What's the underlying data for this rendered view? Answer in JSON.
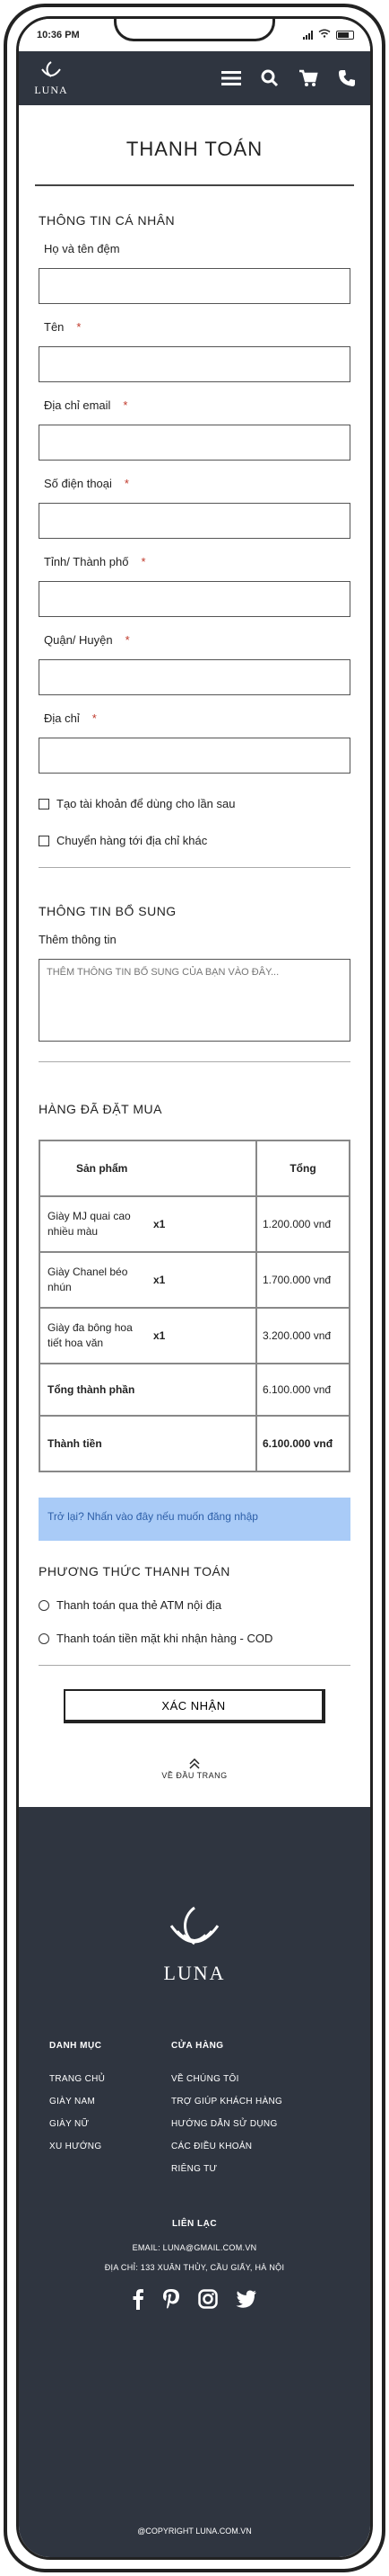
{
  "status_bar": {
    "time": "10:36 PM"
  },
  "header": {
    "logo_text": "LUNA",
    "icons": [
      "menu-icon",
      "search-icon",
      "cart-icon",
      "phone-icon"
    ]
  },
  "page_title": "THANH TOÁN",
  "personal": {
    "section_title": "THÔNG TIN CÁ NHÂN",
    "fields": [
      {
        "label": "Họ và tên đệm",
        "required": ""
      },
      {
        "label": "Tên",
        "required": "*"
      },
      {
        "label": "Địa chỉ email",
        "required": "*"
      },
      {
        "label": "Số điện thoại",
        "required": "*"
      },
      {
        "label": "Tỉnh/ Thành phố",
        "required": "*"
      },
      {
        "label": "Quận/ Huyện",
        "required": "*"
      },
      {
        "label": "Địa chỉ",
        "required": "*"
      }
    ],
    "create_account": "Tạo tài khoản để dùng cho lần sau",
    "ship_other": "Chuyển hàng tới địa chỉ khác"
  },
  "extra": {
    "section_title": "THÔNG TIN BỔ SUNG",
    "label": "Thêm thông tin",
    "placeholder": "THÊM THÔNG TIN BỔ SUNG CỦA BẠN VÀO ĐÂY..."
  },
  "order": {
    "section_title": "HÀNG ĐÃ ĐẶT MUA",
    "col_product": "Sản phẩm",
    "col_total": "Tổng",
    "items": [
      {
        "name": "Giày MJ quai cao nhiều màu",
        "qty": "x1",
        "total": "1.200.000 vnđ"
      },
      {
        "name": "Giày Chanel béo nhún",
        "qty": "x1",
        "total": "1.700.000 vnđ"
      },
      {
        "name": "Giày đa bông hoa tiết hoa văn",
        "qty": "x1",
        "total": "3.200.000 vnđ"
      }
    ],
    "subtotal_label": "Tổng thành phần",
    "subtotal_value": "6.100.000 vnđ",
    "grand_label": "Thành tiền",
    "grand_value": "6.100.000 vnđ"
  },
  "login_prompt": "Trở lại? Nhấn vào đây nếu muốn đăng nhập",
  "payment": {
    "section_title": "PHƯƠNG THỨC THANH TOÁN",
    "options": [
      "Thanh toán qua thẻ ATM nội địa",
      "Thanh toán tiền mặt khi nhận hàng - COD"
    ]
  },
  "submit_label": "XÁC NHẬN",
  "back_to_top": "VỀ ĐẦU TRANG",
  "footer": {
    "logo_text": "LUNA",
    "col1_title": "DANH MỤC",
    "col1_items": [
      "TRANG CHỦ",
      "GIÀY NAM",
      "GIÀY NỮ",
      "XU HƯỚNG"
    ],
    "col2_title": "CỬA HÀNG",
    "col2_items": [
      "VỀ CHÚNG TÔI",
      "TRỢ GIÚP KHÁCH HÀNG",
      "HƯỚNG DẪN SỬ DỤNG",
      "CÁC ĐIỀU KHOẢN",
      "RIÊNG TƯ"
    ],
    "contact_title": "LIÊN LẠC",
    "email": "EMAIL: LUNA@GMAIL.COM.VN",
    "address": "ĐỊA CHỈ: 133 XUÂN THỦY, CẦU GIẤY, HÀ NỘI",
    "socials": [
      "facebook-icon",
      "pinterest-icon",
      "instagram-icon",
      "twitter-icon"
    ],
    "copyright": "@COPYRIGHT LUNA.COM.VN"
  },
  "colors": {
    "header_bg": "#2f3540",
    "login_box_bg": "#a9cbf7",
    "required": "#c0392b"
  }
}
